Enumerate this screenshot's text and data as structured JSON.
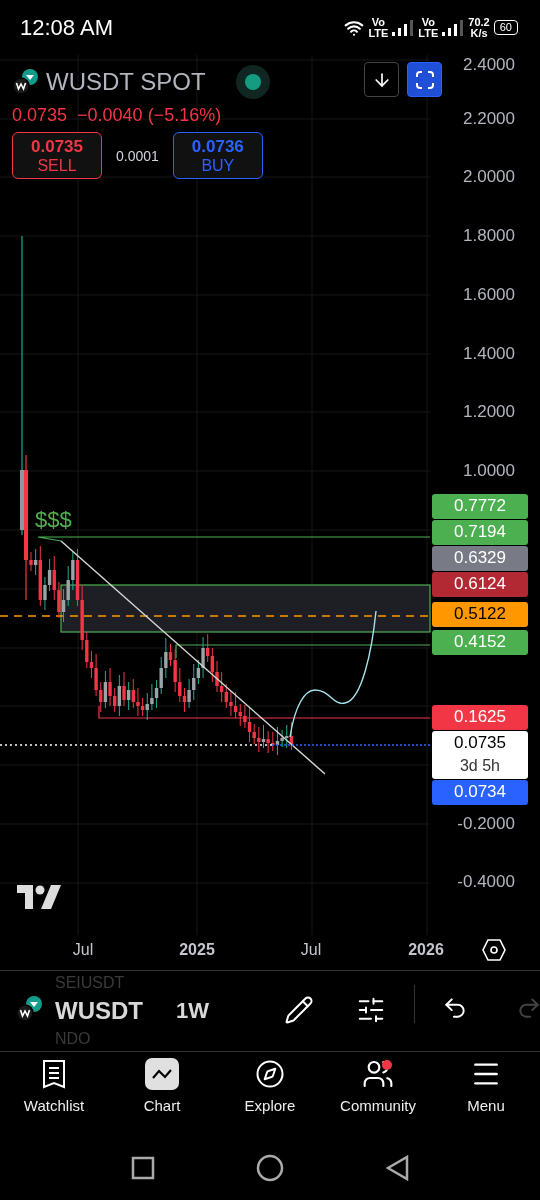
{
  "status_bar": {
    "time": "12:08 AM",
    "sim_1": [
      "Vo",
      "LTE"
    ],
    "sim_2": [
      "Vo",
      "LTE"
    ],
    "speed": [
      "70.2",
      "K/s"
    ],
    "battery": "60"
  },
  "symbol": {
    "name": "WUSDT SPOT"
  },
  "quote": {
    "last": "0.0735",
    "change": "−0.0040 (−5.16%)"
  },
  "trade": {
    "sell_price": "0.0735",
    "sell_label": "SELL",
    "spread": "0.0001",
    "buy_price": "0.0736",
    "buy_label": "BUY"
  },
  "annotation": "$$$",
  "price_axis": {
    "ticks": [
      "2.4000",
      "2.2000",
      "2.0000",
      "1.8000",
      "1.6000",
      "1.4000",
      "1.2000",
      "1.0000",
      "-0.2000",
      "-0.4000"
    ]
  },
  "price_labels": [
    {
      "price": "0.7772",
      "color": "#4caf50"
    },
    {
      "price": "0.7194",
      "color": "#4caf50"
    },
    {
      "price": "0.6329",
      "color": "#787b86"
    },
    {
      "price": "0.6124",
      "color": "#b22833"
    },
    {
      "price": "0.5122",
      "color": "#ff9800"
    },
    {
      "price": "0.4152",
      "color": "#4caf50"
    },
    {
      "price": "0.1625",
      "color": "#f23645"
    },
    {
      "price": "0.0735",
      "color": "#ffffff",
      "kind": "last",
      "countdown": "3d 5h"
    },
    {
      "price": "0.0734",
      "color": "#2962ff"
    }
  ],
  "time_axis": [
    {
      "label": "Jul",
      "kind": "month"
    },
    {
      "label": "2025",
      "kind": "year"
    },
    {
      "label": "Jul",
      "kind": "month"
    },
    {
      "label": "2026",
      "kind": "year"
    }
  ],
  "toolbar": {
    "above": "SEIUSDT",
    "symbol": "WUSDT",
    "below": "NDO",
    "interval": "1W"
  },
  "nav": [
    {
      "label": "Watchlist",
      "selected": false,
      "badge": false
    },
    {
      "label": "Chart",
      "selected": true,
      "badge": false
    },
    {
      "label": "Explore",
      "selected": false,
      "badge": false
    },
    {
      "label": "Community",
      "selected": false,
      "badge": true
    },
    {
      "label": "Menu",
      "selected": false,
      "badge": false
    }
  ]
}
